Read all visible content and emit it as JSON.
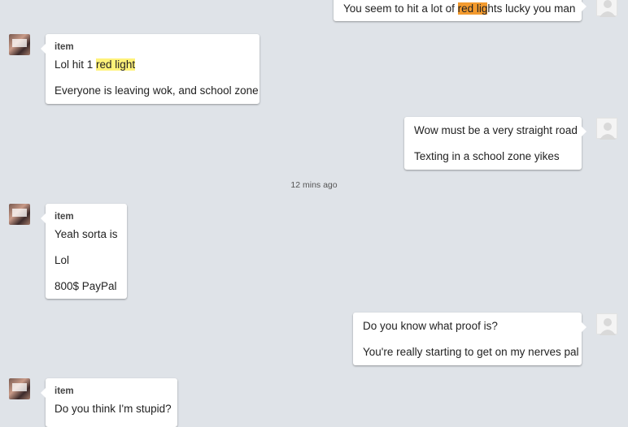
{
  "conversation": {
    "timestamp": "12 mins ago",
    "m1": {
      "pre": "You seem to hit a lot of ",
      "hl_a": "red lig",
      "mid": "hts lucky you man"
    },
    "m2": {
      "sender": "item",
      "l1_pre": "Lol hit 1 ",
      "l1_hl": "red light",
      "l2": "Everyone is leaving wok, and school zone"
    },
    "m3": {
      "l1": "Wow must be a very straight road",
      "l2": "Texting in a school zone yikes"
    },
    "m4": {
      "sender": "item",
      "l1": "Yeah sorta is",
      "l2": "Lol",
      "l3": "800$ PayPal"
    },
    "m5": {
      "l1": "Do you know what proof is?",
      "l2": "You're really starting to get on my nerves pal"
    },
    "m6": {
      "sender": "item",
      "l1": "Do you think I'm stupid?"
    }
  },
  "colors": {
    "background": "#dfe3e8",
    "highlight_yellow": "#fff27a",
    "highlight_orange": "#f39a2e"
  },
  "icons": {
    "incoming_avatar": "contact-photo",
    "outgoing_avatar": "default-user-silhouette"
  }
}
